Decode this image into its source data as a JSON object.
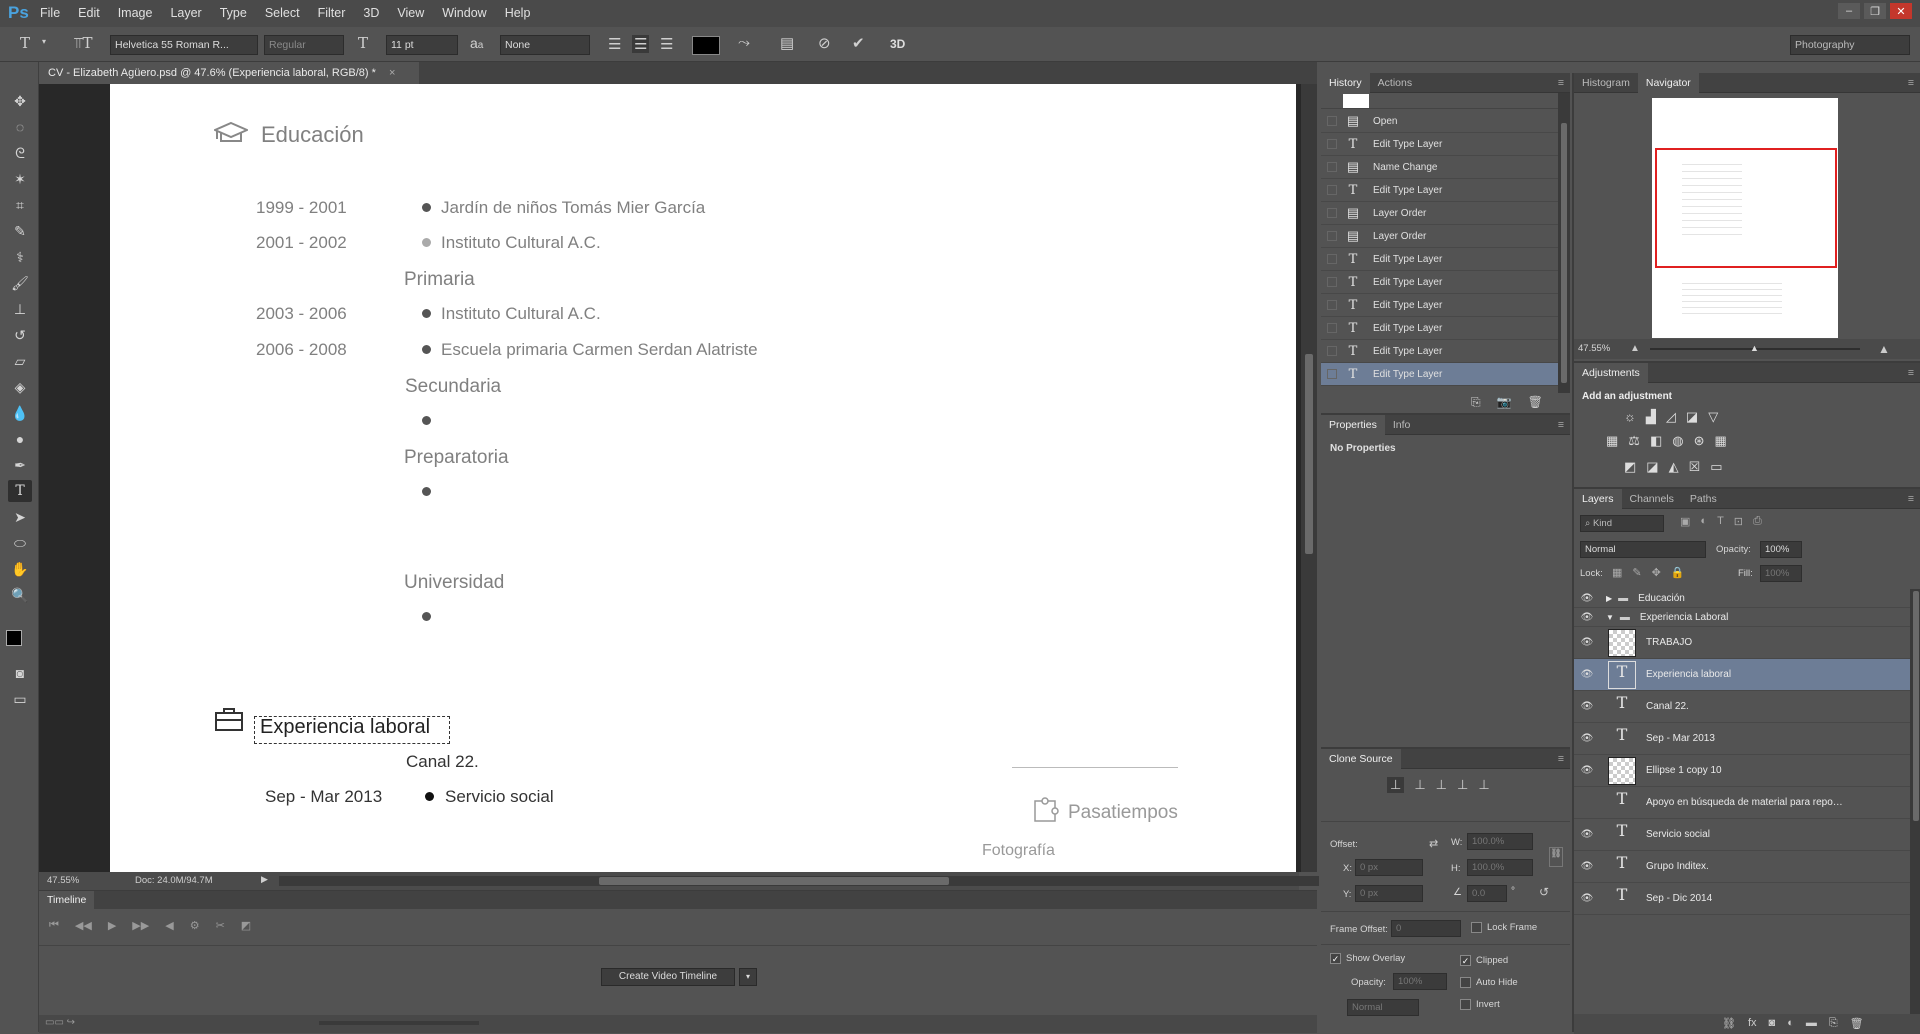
{
  "app": {
    "logo": "Ps"
  },
  "menu": [
    "File",
    "Edit",
    "Image",
    "Layer",
    "Type",
    "Select",
    "Filter",
    "3D",
    "View",
    "Window",
    "Help"
  ],
  "options": {
    "font_family": "Helvetica 55 Roman R...",
    "font_style": "Regular",
    "font_size": "11 pt",
    "aa_label": "a",
    "antialias": "None",
    "threed": "3D",
    "workspace": "Photography",
    "color_swatch": "#000000"
  },
  "document": {
    "tab_title": "CV - Elizabeth Agüero.psd @ 47.6% (Experiencia laboral, RGB/8) *",
    "zoom": "47.55%",
    "doc_size": "Doc: 24.0M/94.7M"
  },
  "cv": {
    "education_title": "Educación",
    "edu_rows": [
      {
        "years": "1999 - 2001",
        "text": "Jardín de niños Tomás Mier García"
      },
      {
        "years": "2001 - 2002",
        "text": "Instituto Cultural A.C."
      },
      {
        "years": "2003 - 2006",
        "text": "Instituto Cultural A.C."
      },
      {
        "years": "2006 - 2008",
        "text": "Escuela primaria Carmen Serdan Alatriste"
      }
    ],
    "level_primaria": "Primaria",
    "level_secundaria": "Secundaria",
    "level_preparatoria": "Preparatoria",
    "level_universidad": "Universidad",
    "work_title": "Experiencia laboral",
    "work_company": "Canal 22.",
    "work_dates": "Sep - Mar 2013",
    "work_item": "Servicio social",
    "hobbies_title": "Pasatiempos",
    "hobby_1": "Fotografía"
  },
  "timeline": {
    "title": "Timeline",
    "create_button": "Create Video Timeline"
  },
  "history": {
    "tabs": [
      "History",
      "Actions"
    ],
    "items": [
      {
        "label": "Open",
        "icon": "doc-icon"
      },
      {
        "label": "Edit Type Layer",
        "icon": "type-icon"
      },
      {
        "label": "Name Change",
        "icon": "doc-icon"
      },
      {
        "label": "Edit Type Layer",
        "icon": "type-icon"
      },
      {
        "label": "Layer Order",
        "icon": "doc-icon"
      },
      {
        "label": "Layer Order",
        "icon": "doc-icon"
      },
      {
        "label": "Edit Type Layer",
        "icon": "type-icon"
      },
      {
        "label": "Edit Type Layer",
        "icon": "type-icon"
      },
      {
        "label": "Edit Type Layer",
        "icon": "type-icon"
      },
      {
        "label": "Edit Type Layer",
        "icon": "type-icon"
      },
      {
        "label": "Edit Type Layer",
        "icon": "type-icon"
      },
      {
        "label": "Edit Type Layer",
        "icon": "type-icon"
      }
    ],
    "selected_index": 11
  },
  "properties": {
    "tabs": [
      "Properties",
      "Info"
    ],
    "empty_text": "No Properties"
  },
  "clone_source": {
    "title": "Clone Source",
    "offset_label": "Offset:",
    "x_label": "X:",
    "x_value": "0 px",
    "y_label": "Y:",
    "y_value": "0 px",
    "w_label": "W:",
    "w_value": "100.0%",
    "h_label": "H:",
    "h_value": "100.0%",
    "angle_value": "0.0",
    "degree": "°",
    "frame_offset_label": "Frame Offset:",
    "frame_offset_value": "0",
    "lock_frame": "Lock Frame",
    "show_overlay": "Show Overlay",
    "clipped": "Clipped",
    "opacity_label": "Opacity:",
    "opacity_value": "100%",
    "auto_hide": "Auto Hide",
    "mode": "Normal",
    "invert": "Invert"
  },
  "navigator": {
    "tabs": [
      "Histogram",
      "Navigator"
    ],
    "zoom": "47.55%"
  },
  "adjustments": {
    "title": "Adjustments",
    "add_label": "Add an adjustment"
  },
  "layers": {
    "tabs": [
      "Layers",
      "Channels",
      "Paths"
    ],
    "kind": "Kind",
    "blend_mode": "Normal",
    "opacity_label": "Opacity:",
    "opacity": "100%",
    "lock_label": "Lock:",
    "fill_label": "Fill:",
    "fill": "100%",
    "items": [
      {
        "name": "Educación",
        "type": "group-collapsed"
      },
      {
        "name": "Experiencia Laboral",
        "type": "group-open"
      },
      {
        "name": "TRABAJO",
        "type": "pixel"
      },
      {
        "name": "Experiencia laboral",
        "type": "text",
        "selected": true
      },
      {
        "name": "Canal 22.",
        "type": "text"
      },
      {
        "name": "Sep - Mar 2013",
        "type": "text"
      },
      {
        "name": "Ellipse 1 copy 10",
        "type": "shape"
      },
      {
        "name": "Apoyo en búsqueda de material para reportaje...",
        "type": "text",
        "hidden": true
      },
      {
        "name": "Servicio social",
        "type": "text"
      },
      {
        "name": "Grupo Inditex.",
        "type": "text"
      },
      {
        "name": "Sep - Dic 2014",
        "type": "text"
      }
    ]
  }
}
